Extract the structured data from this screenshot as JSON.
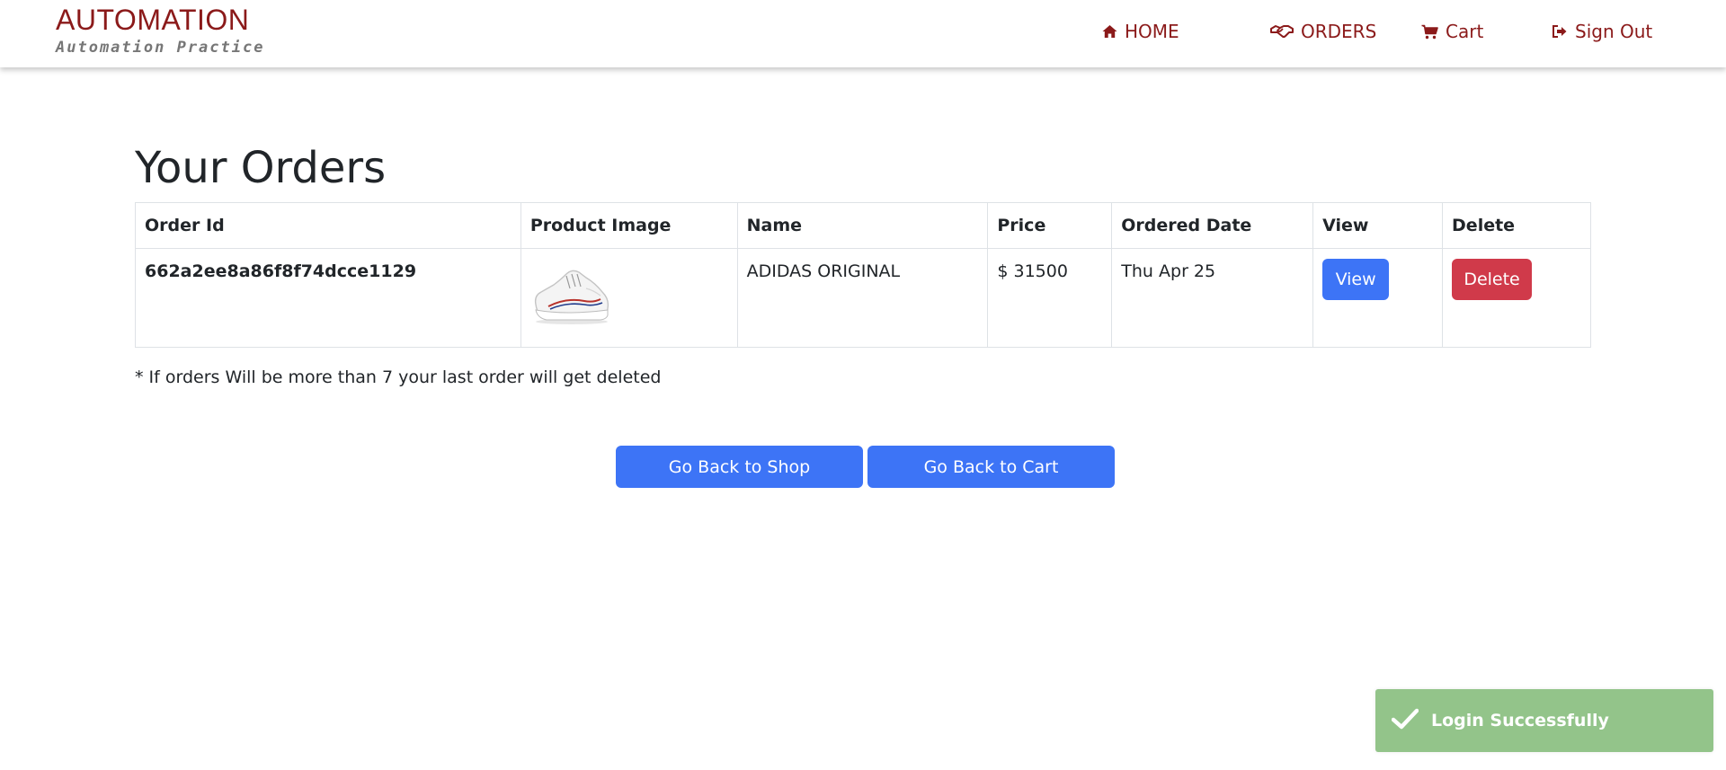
{
  "brand": {
    "title": "AUTOMATION",
    "subtitle": "Automation Practice"
  },
  "nav": {
    "home": {
      "label": "HOME",
      "icon": "home-icon"
    },
    "orders": {
      "label": "ORDERS",
      "icon": "handshake-icon"
    },
    "cart": {
      "label": "Cart",
      "icon": "cart-icon"
    },
    "signout": {
      "label": "Sign Out",
      "icon": "sign-out-icon"
    }
  },
  "main": {
    "title": "Your Orders",
    "table": {
      "headers": {
        "order_id": "Order Id",
        "product_image": "Product Image",
        "name": "Name",
        "price": "Price",
        "ordered_date": "Ordered Date",
        "view": "View",
        "delete": "Delete"
      },
      "rows": [
        {
          "order_id": "662a2ee8a86f8f74dcce1129",
          "product_image": "white-sneaker-image",
          "name": "ADIDAS ORIGINAL",
          "price": "$ 31500",
          "ordered_date": "Thu Apr 25",
          "view_label": "View",
          "delete_label": "Delete"
        }
      ]
    },
    "note": "* If orders Will be more than 7 your last order will get deleted",
    "buttons": {
      "back_to_shop": "Go Back to Shop",
      "back_to_cart": "Go Back to Cart"
    }
  },
  "toast": {
    "message": "Login Successfully",
    "icon": "check-icon"
  },
  "colors": {
    "brand": "#8b1a1a",
    "primary": "#3d74f6",
    "danger": "#d03a4a",
    "toast_success": "#93c48a"
  }
}
